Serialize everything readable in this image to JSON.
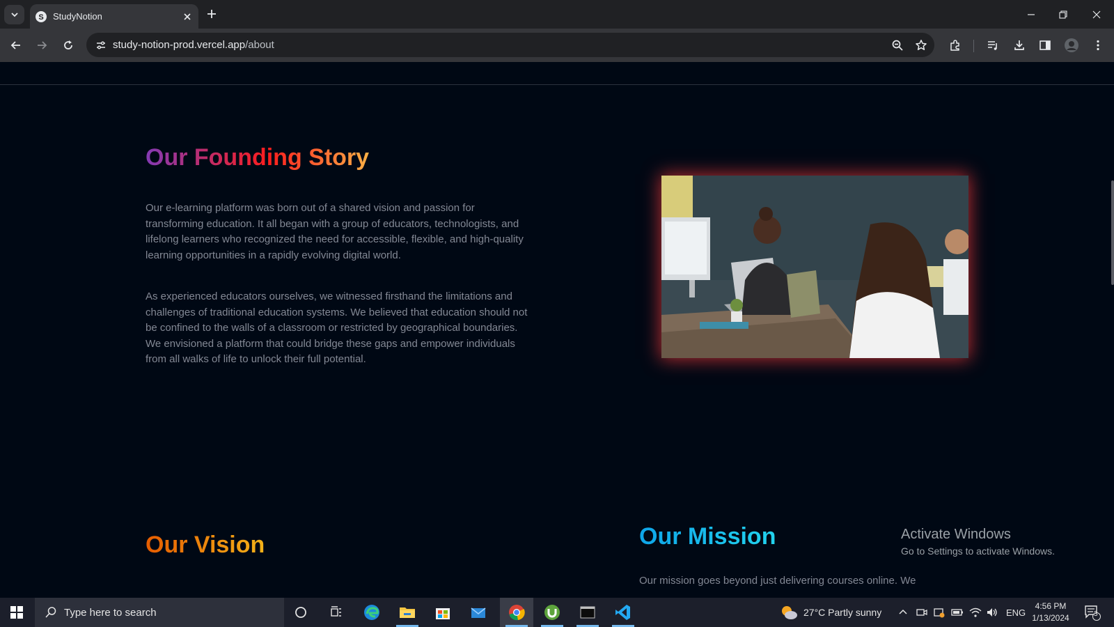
{
  "browser": {
    "tab_title": "StudyNotion",
    "url_host": "study-notion-prod.vercel.app",
    "url_path": "/about"
  },
  "founding": {
    "title": "Our Founding Story",
    "paragraph1": "Our e-learning platform was born out of a shared vision and passion for transforming education. It all began with a group of educators, technologists, and lifelong learners who recognized the need for accessible, flexible, and high-quality learning opportunities in a rapidly evolving digital world.",
    "paragraph2": "As experienced educators ourselves, we witnessed firsthand the limitations and challenges of traditional education systems. We believed that education should not be confined to the walls of a classroom or restricted by geographical boundaries. We envisioned a platform that could bridge these gaps and empower individuals from all walks of life to unlock their full potential."
  },
  "vision": {
    "title": "Our Vision"
  },
  "mission": {
    "title": "Our Mission",
    "text": "Our mission goes beyond just delivering courses online. We"
  },
  "watermark": {
    "line1": "Activate Windows",
    "line2": "Go to Settings to activate Windows."
  },
  "taskbar": {
    "search_placeholder": "Type here to search",
    "weather": "27°C  Partly sunny",
    "language": "ENG",
    "time": "4:56 PM",
    "date": "1/13/2024",
    "notification_count": "3"
  },
  "colors": {
    "page_bg": "#000814",
    "body_text": "#838894",
    "founding_gradient": [
      "#833ab4",
      "#fd1d1d",
      "#fcb045"
    ],
    "vision_gradient": [
      "#e65c00",
      "#f9d423"
    ],
    "mission_gradient": [
      "#0ea5e9",
      "#22d3ee"
    ]
  }
}
